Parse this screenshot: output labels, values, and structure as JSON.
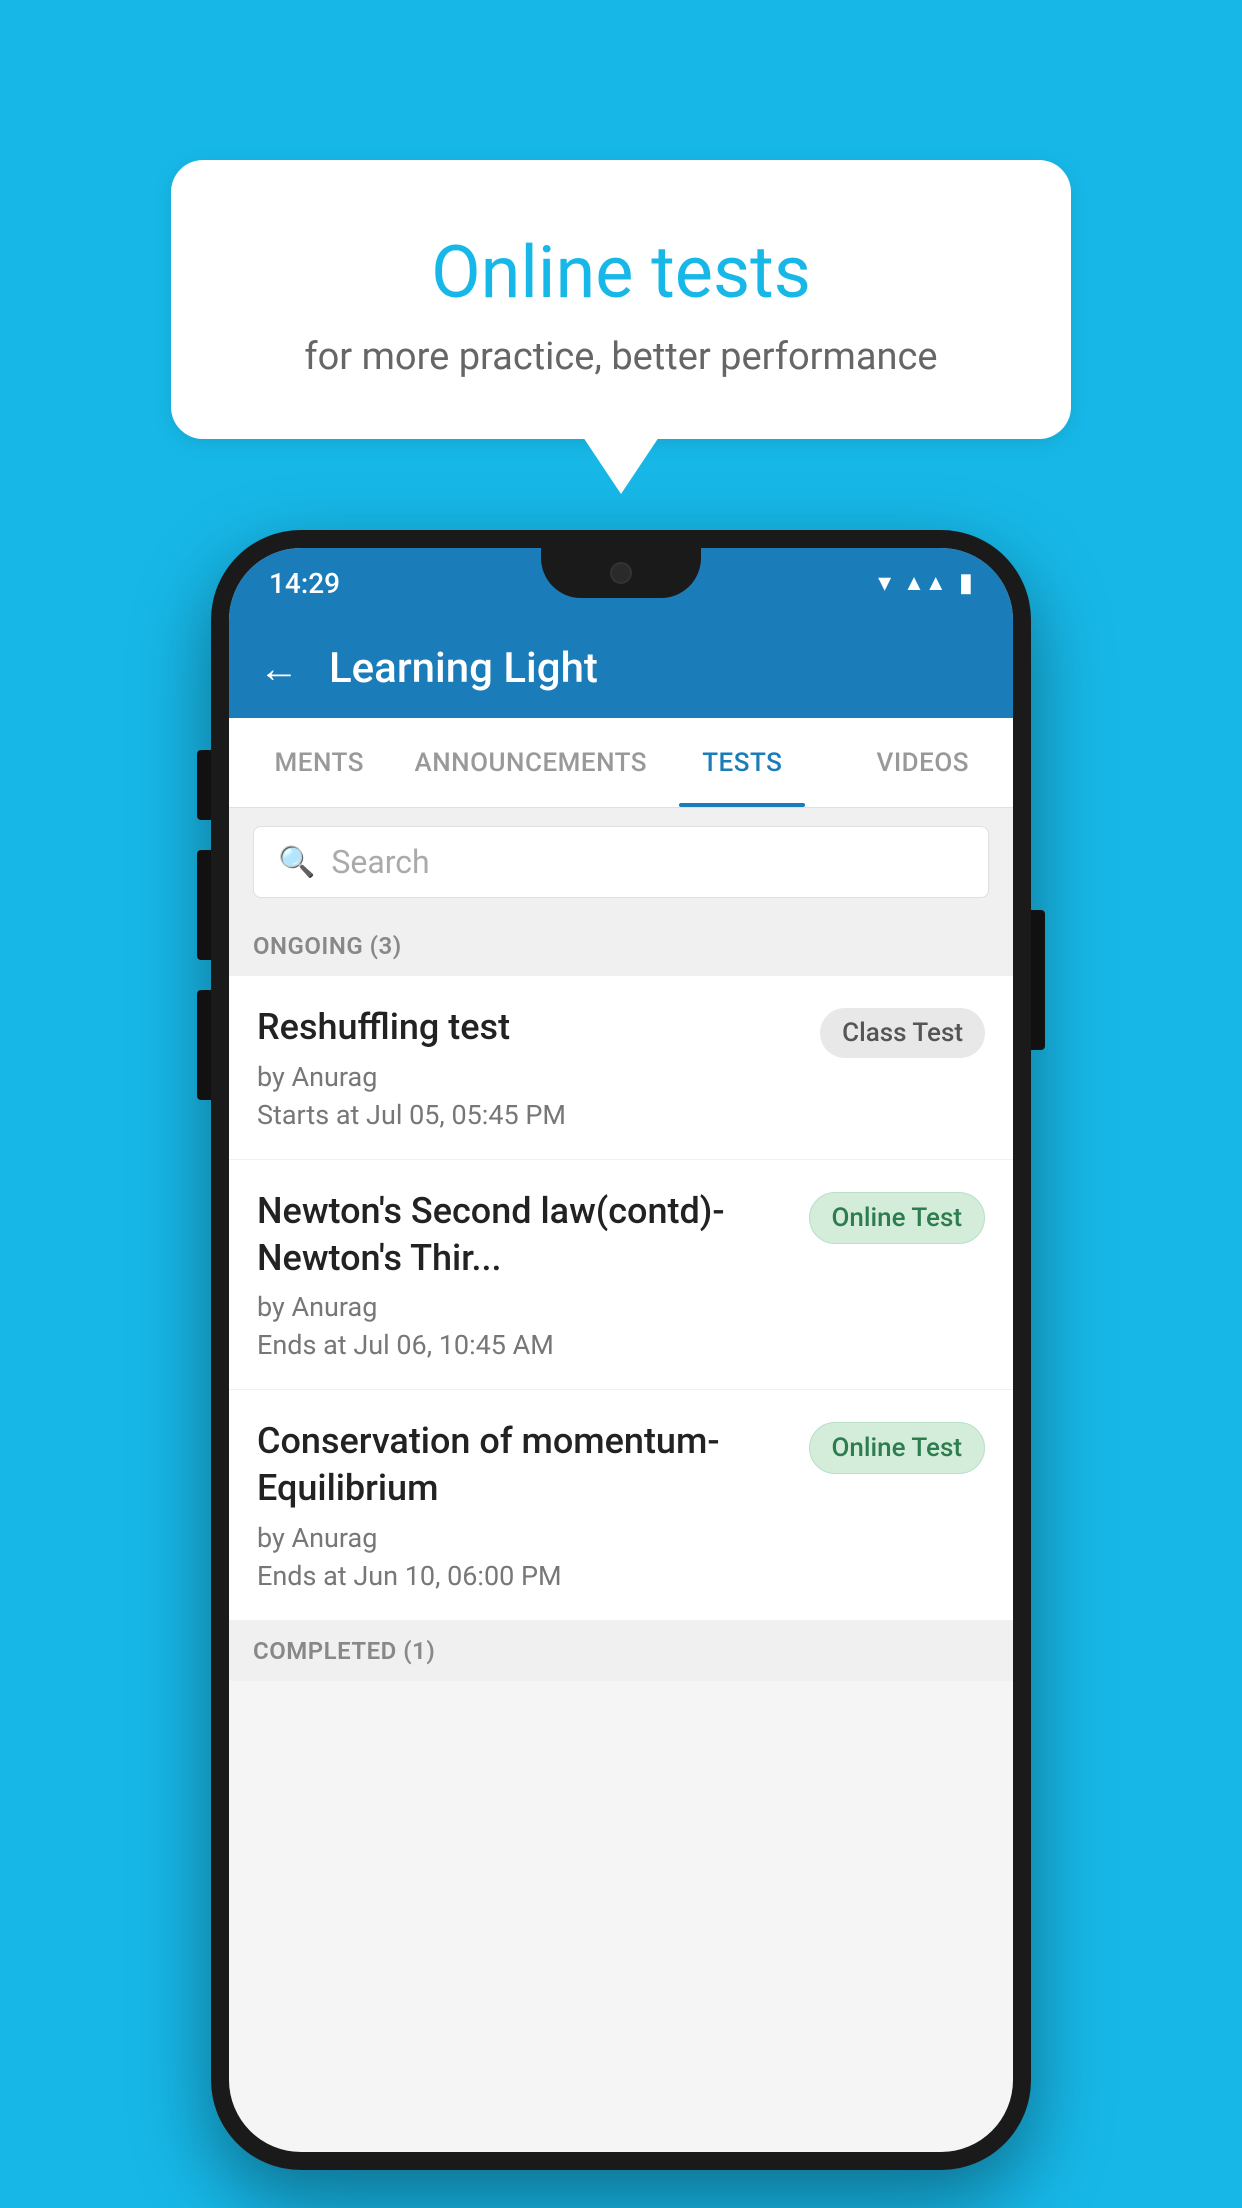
{
  "promo": {
    "title": "Online tests",
    "subtitle": "for more practice, better performance"
  },
  "statusBar": {
    "time": "14:29",
    "icons": [
      "wifi",
      "signal",
      "battery"
    ]
  },
  "appBar": {
    "title": "Learning Light",
    "backLabel": "←"
  },
  "tabs": [
    {
      "label": "MENTS",
      "active": false
    },
    {
      "label": "ANNOUNCEMENTS",
      "active": false
    },
    {
      "label": "TESTS",
      "active": true
    },
    {
      "label": "VIDEOS",
      "active": false
    }
  ],
  "search": {
    "placeholder": "Search"
  },
  "ongoingSection": {
    "label": "ONGOING (3)"
  },
  "tests": [
    {
      "name": "Reshuffling test",
      "by": "by Anurag",
      "time": "Starts at  Jul 05, 05:45 PM",
      "badge": "Class Test",
      "badgeType": "class"
    },
    {
      "name": "Newton's Second law(contd)-Newton's Thir...",
      "by": "by Anurag",
      "time": "Ends at  Jul 06, 10:45 AM",
      "badge": "Online Test",
      "badgeType": "online"
    },
    {
      "name": "Conservation of momentum-Equilibrium",
      "by": "by Anurag",
      "time": "Ends at  Jun 10, 06:00 PM",
      "badge": "Online Test",
      "badgeType": "online"
    }
  ],
  "completedSection": {
    "label": "COMPLETED (1)"
  }
}
